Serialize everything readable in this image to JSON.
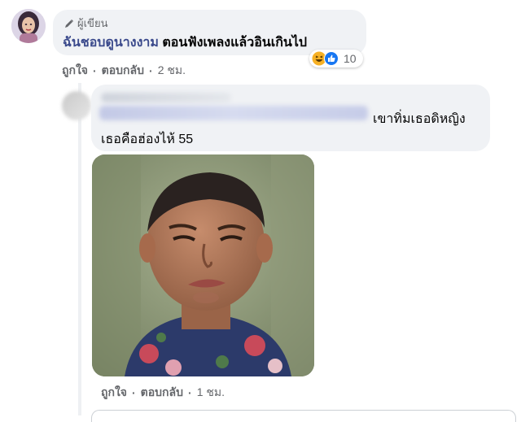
{
  "comment": {
    "author_badge": "ผู้เขียน",
    "text_highlight": "ฉันชอบดูนางงาม",
    "text_rest": " ตอนฟังเพลงแล้วอินเกินไป",
    "reaction_count": "10",
    "reaction_icons": [
      "haha-emoji-icon",
      "like-icon"
    ],
    "actions": {
      "like": "ถูกใจ",
      "reply": "ตอบกลับ",
      "separator": "·",
      "time": "2 ชม."
    }
  },
  "reply": {
    "text_line1": "เขาทิ่มเธอดิหญิง",
    "text_line2": "เธอคือฮ่องไห้ 55",
    "actions": {
      "like": "ถูกใจ",
      "reply": "ตอบกลับ",
      "separator": "·",
      "time": "1 ชม."
    }
  },
  "colors": {
    "bubble": "#f0f2f5",
    "secondary_text": "#65676b",
    "mention": "#3b4a8c",
    "like_blue": "#1877f2",
    "haha_yellow": "#f7b125"
  }
}
